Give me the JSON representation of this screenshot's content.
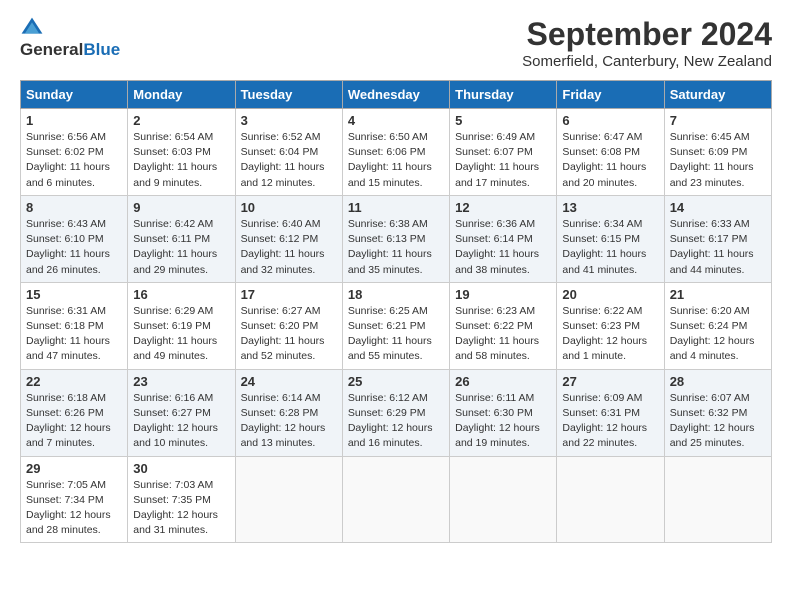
{
  "header": {
    "logo_line1": "General",
    "logo_line2": "Blue",
    "title": "September 2024",
    "subtitle": "Somerfield, Canterbury, New Zealand"
  },
  "calendar": {
    "headers": [
      "Sunday",
      "Monday",
      "Tuesday",
      "Wednesday",
      "Thursday",
      "Friday",
      "Saturday"
    ],
    "weeks": [
      [
        {
          "day": "1",
          "info": "Sunrise: 6:56 AM\nSunset: 6:02 PM\nDaylight: 11 hours\nand 6 minutes."
        },
        {
          "day": "2",
          "info": "Sunrise: 6:54 AM\nSunset: 6:03 PM\nDaylight: 11 hours\nand 9 minutes."
        },
        {
          "day": "3",
          "info": "Sunrise: 6:52 AM\nSunset: 6:04 PM\nDaylight: 11 hours\nand 12 minutes."
        },
        {
          "day": "4",
          "info": "Sunrise: 6:50 AM\nSunset: 6:06 PM\nDaylight: 11 hours\nand 15 minutes."
        },
        {
          "day": "5",
          "info": "Sunrise: 6:49 AM\nSunset: 6:07 PM\nDaylight: 11 hours\nand 17 minutes."
        },
        {
          "day": "6",
          "info": "Sunrise: 6:47 AM\nSunset: 6:08 PM\nDaylight: 11 hours\nand 20 minutes."
        },
        {
          "day": "7",
          "info": "Sunrise: 6:45 AM\nSunset: 6:09 PM\nDaylight: 11 hours\nand 23 minutes."
        }
      ],
      [
        {
          "day": "8",
          "info": "Sunrise: 6:43 AM\nSunset: 6:10 PM\nDaylight: 11 hours\nand 26 minutes."
        },
        {
          "day": "9",
          "info": "Sunrise: 6:42 AM\nSunset: 6:11 PM\nDaylight: 11 hours\nand 29 minutes."
        },
        {
          "day": "10",
          "info": "Sunrise: 6:40 AM\nSunset: 6:12 PM\nDaylight: 11 hours\nand 32 minutes."
        },
        {
          "day": "11",
          "info": "Sunrise: 6:38 AM\nSunset: 6:13 PM\nDaylight: 11 hours\nand 35 minutes."
        },
        {
          "day": "12",
          "info": "Sunrise: 6:36 AM\nSunset: 6:14 PM\nDaylight: 11 hours\nand 38 minutes."
        },
        {
          "day": "13",
          "info": "Sunrise: 6:34 AM\nSunset: 6:15 PM\nDaylight: 11 hours\nand 41 minutes."
        },
        {
          "day": "14",
          "info": "Sunrise: 6:33 AM\nSunset: 6:17 PM\nDaylight: 11 hours\nand 44 minutes."
        }
      ],
      [
        {
          "day": "15",
          "info": "Sunrise: 6:31 AM\nSunset: 6:18 PM\nDaylight: 11 hours\nand 47 minutes."
        },
        {
          "day": "16",
          "info": "Sunrise: 6:29 AM\nSunset: 6:19 PM\nDaylight: 11 hours\nand 49 minutes."
        },
        {
          "day": "17",
          "info": "Sunrise: 6:27 AM\nSunset: 6:20 PM\nDaylight: 11 hours\nand 52 minutes."
        },
        {
          "day": "18",
          "info": "Sunrise: 6:25 AM\nSunset: 6:21 PM\nDaylight: 11 hours\nand 55 minutes."
        },
        {
          "day": "19",
          "info": "Sunrise: 6:23 AM\nSunset: 6:22 PM\nDaylight: 11 hours\nand 58 minutes."
        },
        {
          "day": "20",
          "info": "Sunrise: 6:22 AM\nSunset: 6:23 PM\nDaylight: 12 hours\nand 1 minute."
        },
        {
          "day": "21",
          "info": "Sunrise: 6:20 AM\nSunset: 6:24 PM\nDaylight: 12 hours\nand 4 minutes."
        }
      ],
      [
        {
          "day": "22",
          "info": "Sunrise: 6:18 AM\nSunset: 6:26 PM\nDaylight: 12 hours\nand 7 minutes."
        },
        {
          "day": "23",
          "info": "Sunrise: 6:16 AM\nSunset: 6:27 PM\nDaylight: 12 hours\nand 10 minutes."
        },
        {
          "day": "24",
          "info": "Sunrise: 6:14 AM\nSunset: 6:28 PM\nDaylight: 12 hours\nand 13 minutes."
        },
        {
          "day": "25",
          "info": "Sunrise: 6:12 AM\nSunset: 6:29 PM\nDaylight: 12 hours\nand 16 minutes."
        },
        {
          "day": "26",
          "info": "Sunrise: 6:11 AM\nSunset: 6:30 PM\nDaylight: 12 hours\nand 19 minutes."
        },
        {
          "day": "27",
          "info": "Sunrise: 6:09 AM\nSunset: 6:31 PM\nDaylight: 12 hours\nand 22 minutes."
        },
        {
          "day": "28",
          "info": "Sunrise: 6:07 AM\nSunset: 6:32 PM\nDaylight: 12 hours\nand 25 minutes."
        }
      ],
      [
        {
          "day": "29",
          "info": "Sunrise: 7:05 AM\nSunset: 7:34 PM\nDaylight: 12 hours\nand 28 minutes."
        },
        {
          "day": "30",
          "info": "Sunrise: 7:03 AM\nSunset: 7:35 PM\nDaylight: 12 hours\nand 31 minutes."
        },
        {
          "day": "",
          "info": ""
        },
        {
          "day": "",
          "info": ""
        },
        {
          "day": "",
          "info": ""
        },
        {
          "day": "",
          "info": ""
        },
        {
          "day": "",
          "info": ""
        }
      ]
    ]
  }
}
